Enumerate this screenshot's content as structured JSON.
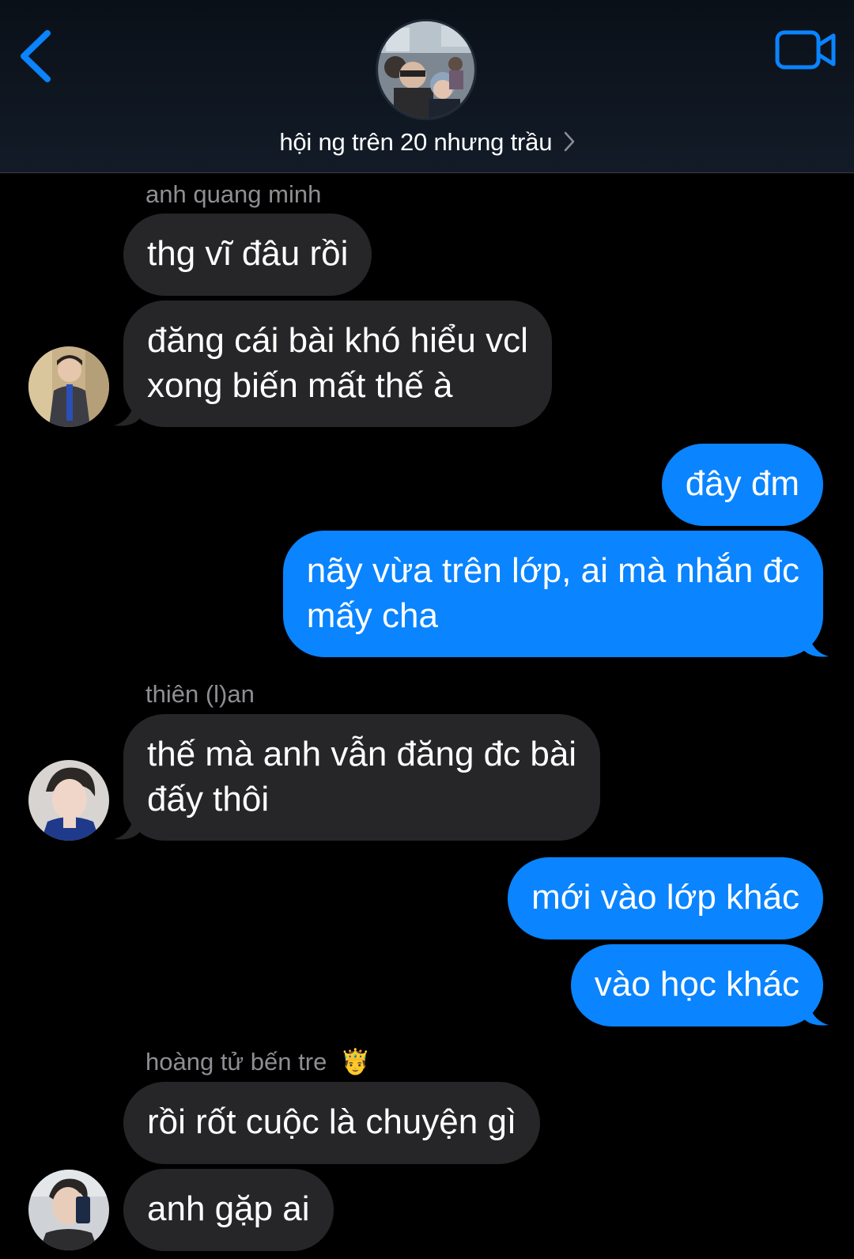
{
  "header": {
    "group_name": "hội ng trên 20 nhưng trầu",
    "group_avatar_icon": "group-photo-avatar",
    "back_icon": "chevron-left-icon",
    "video_icon": "video-camera-icon",
    "accent_color": "#0a84ff"
  },
  "messages": [
    {
      "type": "sender",
      "name": "anh quang minh"
    },
    {
      "type": "incoming",
      "text": "thg vĩ đâu rồi"
    },
    {
      "type": "incoming",
      "lines": [
        "đăng cái bài khó hiểu vcl",
        "xong biến mất thế à"
      ]
    },
    {
      "type": "outgoing",
      "text": "đây đm"
    },
    {
      "type": "outgoing",
      "lines": [
        "nãy vừa trên lớp, ai mà nhắn đc",
        "mấy cha"
      ]
    },
    {
      "type": "sender",
      "name": "thiên (l)an"
    },
    {
      "type": "incoming",
      "lines": [
        "thế mà anh vẫn đăng đc bài",
        "đấy thôi"
      ]
    },
    {
      "type": "outgoing",
      "text": "mới vào lớp khác"
    },
    {
      "type": "outgoing",
      "text": "vào học khác"
    },
    {
      "type": "sender",
      "name": "hoàng tử bến tre",
      "emoji": "🤴"
    },
    {
      "type": "incoming",
      "text": "rồi rốt cuộc là chuyện gì"
    },
    {
      "type": "incoming",
      "text": "anh gặp ai"
    }
  ],
  "colors": {
    "incoming_bubble": "#262628",
    "outgoing_bubble": "#0a84ff",
    "sender_label": "#8e8e93",
    "background": "#000000"
  }
}
